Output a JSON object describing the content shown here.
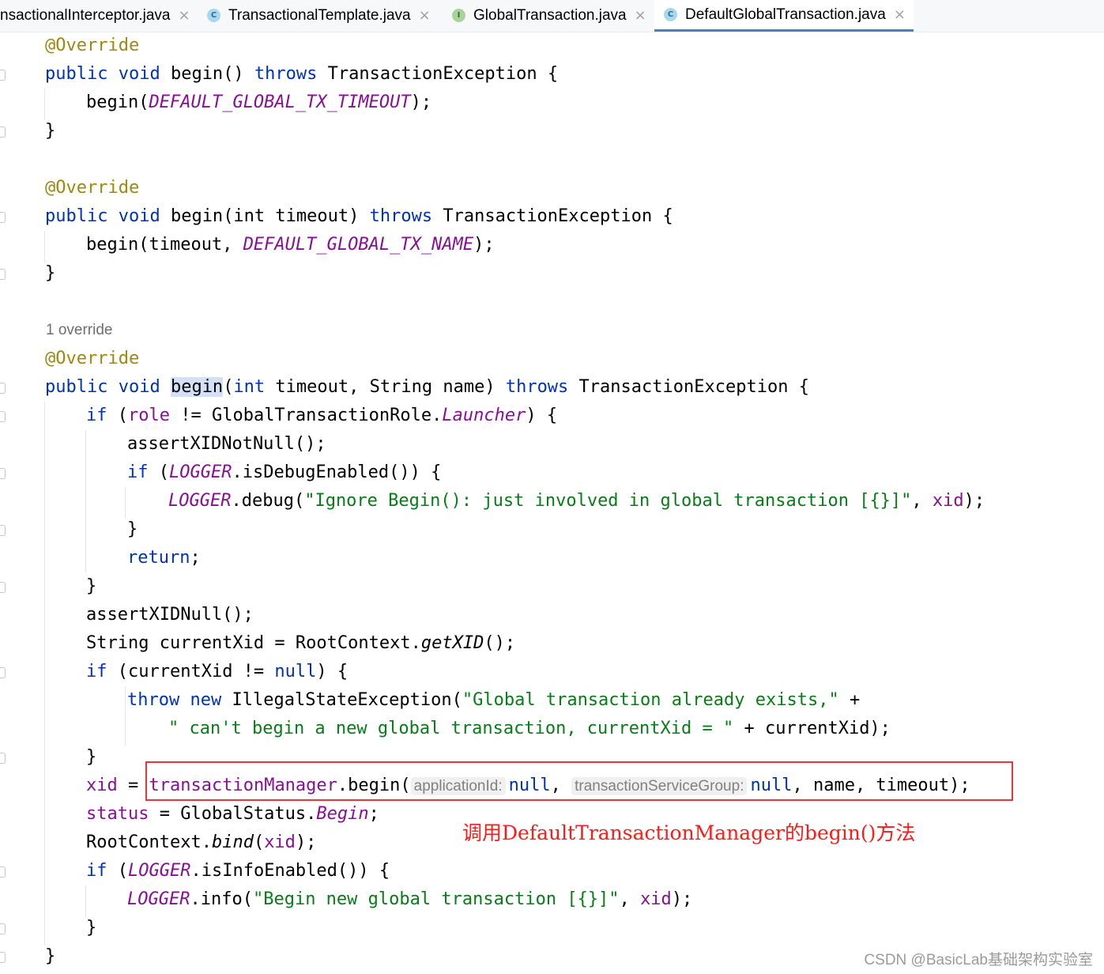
{
  "tabs": [
    {
      "label": "nsactionalInterceptor.java",
      "kind": "class",
      "active": false
    },
    {
      "label": "TransactionalTemplate.java",
      "kind": "class",
      "active": false
    },
    {
      "label": "GlobalTransaction.java",
      "kind": "interface",
      "active": false
    },
    {
      "label": "DefaultGlobalTransaction.java",
      "kind": "class",
      "active": true
    }
  ],
  "tab_icons": {
    "class": "C",
    "interface": "I"
  },
  "close_glyph": "×",
  "code": {
    "override": "@Override",
    "m1_sig_a": "public void ",
    "m1_name": "begin",
    "m1_sig_b": "() ",
    "throws": "throws",
    "exc": " TransactionException {",
    "m1_body_a": "begin(",
    "m1_body_const": "DEFAULT_GLOBAL_TX_TIMEOUT",
    "m1_body_b": ");",
    "close_brace": "}",
    "m2_params": "(int timeout) ",
    "m2_body_a": "begin(timeout, ",
    "m2_body_const": "DEFAULT_GLOBAL_TX_NAME",
    "override_lens": "1 override",
    "m3_params_a": "(",
    "m3_params_b": "int",
    "m3_params_c": " timeout, String name) ",
    "if_kw": "if",
    "if1_a": " (",
    "if1_role": "role",
    "if1_b": " != GlobalTransactionRole.",
    "if1_launcher": "Launcher",
    "if1_c": ") {",
    "assert_not_null": "assertXIDNotNull();",
    "logger": "LOGGER",
    "debug_enabled": ".isDebugEnabled()) {",
    "debug_call": ".debug(",
    "debug_str": "\"Ignore Begin(): just involved in global transaction [{}]\"",
    "comma_sp": ", ",
    "xid": "xid",
    "close_call": ");",
    "return_kw": "return",
    "semi": ";",
    "assert_null": "assertXIDNull();",
    "current_xid_a": "String currentXid = RootContext.",
    "get_xid": "getXID",
    "current_xid_b": "();",
    "if3_a": " (currentXid != ",
    "null_kw": "null",
    "if3_b": ") {",
    "throw_kw": "throw",
    "new_kw": "new",
    "throw_b": " IllegalStateException(",
    "throw_str1": "\"Global transaction already exists,\"",
    "plus": " +",
    "throw_str2": "\" can't begin a new global transaction, currentXid = \"",
    "throw_tail": " + currentXid);",
    "assign_eq": " = ",
    "tx_manager": "transactionManager",
    "begin_call": ".begin(",
    "hint_app": "applicationId:",
    "hint_group": "transactionServiceGroup:",
    "tx_tail": ", name, timeout);",
    "status_fld": "status",
    "status_b": " = GlobalStatus.",
    "status_begin": "Begin",
    "bind_a": "RootContext.",
    "bind_fn": "bind",
    "bind_b": "(",
    "info_enabled": ".isInfoEnabled()) {",
    "info_call": ".info(",
    "info_str": "\"Begin new global transaction [{}]\""
  },
  "annotation_note": "调用DefaultTransactionManager的begin()方法",
  "watermark": "CSDN @BasicLab基础架构实验室"
}
